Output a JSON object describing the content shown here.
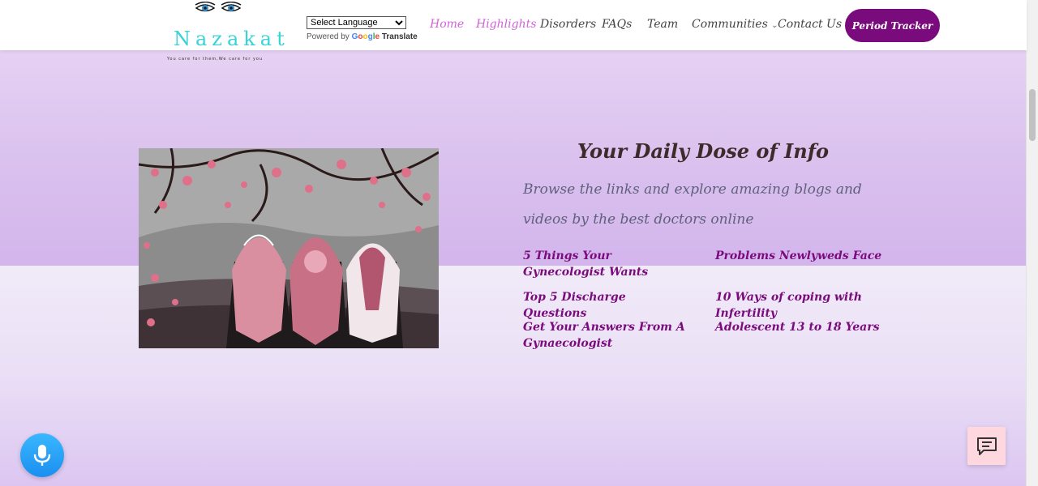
{
  "header": {
    "brand": "Nazakat",
    "tagline": "You care for them,We care for you",
    "language_select": "Select Language",
    "powered_by": "Powered by",
    "google": "Google",
    "translate": "Translate",
    "nav": [
      {
        "label": "Home",
        "active": true
      },
      {
        "label": "Highlights",
        "active": true
      },
      {
        "label": "Disorders",
        "active": false
      },
      {
        "label": "FAQs",
        "active": false
      },
      {
        "label": "Team",
        "active": false
      },
      {
        "label": "Communities",
        "active": false
      },
      {
        "label": "Contact Us",
        "active": false
      }
    ],
    "cta": "Period Tracker"
  },
  "info": {
    "title": "Your Daily Dose of Info",
    "description": "Browse the links and explore amazing blogs and videos by the best doctors online",
    "links": [
      "5 Things Your Gynecologist Wants",
      "Problems Newlyweds Face",
      "Top 5 Discharge Questions",
      "10 Ways of coping with Infertility",
      "Get Your Answers From A Gynaecologist",
      "Adolescent 13 to 18 Years"
    ]
  },
  "floating": {
    "mic_icon": "microphone-icon",
    "chat_icon": "chat-icon"
  },
  "colors": {
    "brand_purple": "#7a0b7c",
    "active_nav": "#d162d8",
    "logo_teal": "#36d3d8",
    "mic_blue": "#1a8ff0",
    "chat_pink": "#ffd7df"
  }
}
